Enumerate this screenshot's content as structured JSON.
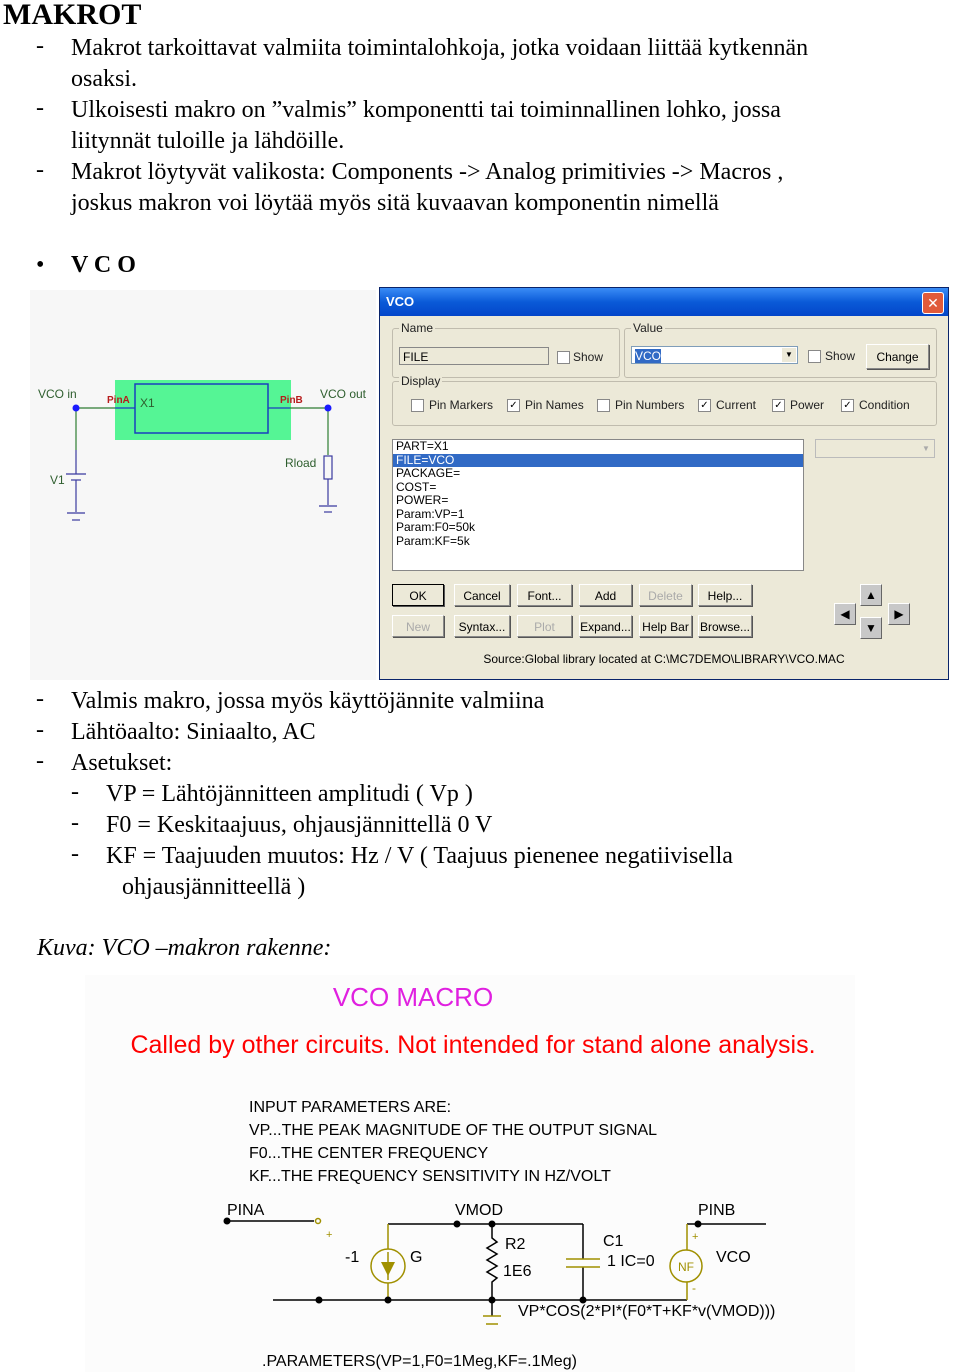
{
  "title": "MAKROT",
  "bullets1": [
    {
      "lines": [
        "Makrot tarkoittavat valmiita toimintalohkoja, jotka voidaan liittää kytkennän",
        "osaksi."
      ]
    },
    {
      "lines": [
        "Ulkoisesti makro on ”valmis” komponentti tai toiminnallinen lohko, jossa",
        "liitynnät tuloille ja lähdöille."
      ]
    },
    {
      "lines": [
        "Makrot löytyvät valikosta:  Components -> Analog primitivies -> Macros ,",
        "joskus makron voi löytää myös sitä kuvaavan komponentin nimellä"
      ]
    }
  ],
  "section": "V C O",
  "schematic1": {
    "vco_in": "VCO in",
    "pin_a": "PinA",
    "x1": "X1",
    "pin_b": "PinB",
    "vco_out": "VCO out",
    "v1": "V1",
    "rload": "Rload",
    "colors": {
      "block": "#55f595",
      "wire": "#2e7d32",
      "pin": "#b71c1c",
      "node": "#1a1aff"
    }
  },
  "dialog": {
    "title": "VCO",
    "name_group": "Name",
    "name_value": "FILE",
    "show": "Show",
    "value_group": "Value",
    "value_value": "VCO",
    "change": "Change",
    "display_group": "Display",
    "display": [
      {
        "label": "Pin Markers",
        "checked": false
      },
      {
        "label": "Pin Names",
        "checked": true
      },
      {
        "label": "Pin Numbers",
        "checked": false
      },
      {
        "label": "Current",
        "checked": true
      },
      {
        "label": "Power",
        "checked": true
      },
      {
        "label": "Condition",
        "checked": true
      }
    ],
    "attributes": [
      "PART=X1",
      "FILE=VCO",
      "PACKAGE=",
      "COST=",
      "POWER=",
      "Param:VP=1",
      "Param:F0=50k",
      "Param:KF=5k"
    ],
    "selected_attribute": "FILE=VCO",
    "buttons_row1": [
      {
        "label": "OK",
        "enabled": true
      },
      {
        "label": "Cancel",
        "enabled": true
      },
      {
        "label": "Font...",
        "enabled": true
      },
      {
        "label": "Add",
        "enabled": true
      },
      {
        "label": "Delete",
        "enabled": false
      },
      {
        "label": "Help...",
        "enabled": true
      }
    ],
    "buttons_row2": [
      {
        "label": "New",
        "enabled": false
      },
      {
        "label": "Syntax...",
        "enabled": true
      },
      {
        "label": "Plot",
        "enabled": false
      },
      {
        "label": "Expand...",
        "enabled": true
      },
      {
        "label": "Help Bar",
        "enabled": true
      },
      {
        "label": "Browse...",
        "enabled": true
      }
    ],
    "source": "Source:Global library located at C:\\MC7DEMO\\LIBRARY\\VCO.MAC"
  },
  "bullets2": [
    "Valmis makro, jossa myös käyttöjännite valmiina",
    "Lähtöaalto: Siniaalto, AC",
    "Asetukset:"
  ],
  "sub": [
    {
      "lines": [
        "VP = Lähtöjännitteen amplitudi ( Vp )"
      ]
    },
    {
      "lines": [
        "F0 = Keskitaajuus, ohjausjännittellä 0 V"
      ]
    },
    {
      "lines": [
        "KF = Taajuuden muutos: Hz / V ( Taajuus pienenee negatiivisella",
        "ohjausjännitteellä )"
      ]
    }
  ],
  "caption": "Kuva: VCO –makron rakenne:",
  "figure2": {
    "title": "VCO MACRO",
    "subtitle": "Called by other circuits.  Not intended for stand alone analysis.",
    "params": [
      "INPUT PARAMETERS ARE:",
      "VP...THE PEAK MAGNITUDE OF THE OUTPUT SIGNAL",
      "F0...THE CENTER FREQUENCY",
      "KF...THE FREQUENCY SENSITIVITY IN HZ/VOLT"
    ],
    "pina": "PINA",
    "vmod": "VMOD",
    "pinb": "PINB",
    "plus": "+",
    "minus": "-",
    "gain": "-1",
    "g": "G",
    "r2": "R2",
    "r2v": "1E6",
    "c1": "C1",
    "c1v": "1 IC=0",
    "nf": "NF",
    "vco": "VCO",
    "formula": "VP*COS(2*PI*(F0*T+KF*v(VMOD)))",
    "parameters": ".PARAMETERS(VP=1,F0=1Meg,KF=.1Meg)",
    "colors": {
      "title": "#e020e0",
      "subtitle": "#ff0000",
      "source": "#a09000"
    }
  }
}
